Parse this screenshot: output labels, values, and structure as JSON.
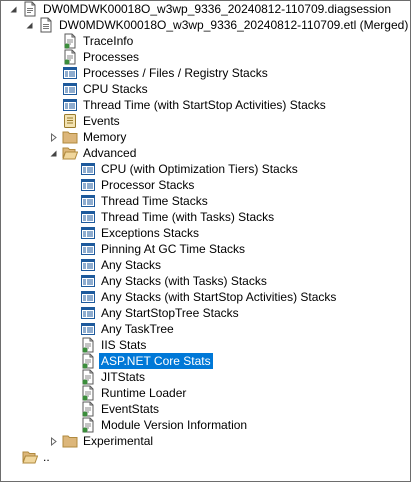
{
  "tree": {
    "root": {
      "label": "DW0MDWK00018O_w3wp_9336_20240812-110709.diagsession",
      "icon": "diagsession-file-icon",
      "expanded": true
    },
    "etl": {
      "label": "DW0MDWK00018O_w3wp_9336_20240812-110709.etl (Merged)",
      "icon": "etl-file-icon",
      "expanded": true
    },
    "top_items": [
      {
        "label": "TraceInfo",
        "icon": "document-icon"
      },
      {
        "label": "Processes",
        "icon": "document-icon"
      },
      {
        "label": "Processes / Files / Registry Stacks",
        "icon": "stack-view-icon"
      },
      {
        "label": "CPU Stacks",
        "icon": "stack-view-icon"
      },
      {
        "label": "Thread Time (with StartStop Activities) Stacks",
        "icon": "stack-view-icon"
      },
      {
        "label": "Events",
        "icon": "events-icon"
      }
    ],
    "memory": {
      "label": "Memory",
      "icon": "folder-icon",
      "expanded": false
    },
    "advanced": {
      "label": "Advanced",
      "icon": "folder-open-icon",
      "expanded": true
    },
    "advanced_items": [
      {
        "label": "CPU (with Optimization Tiers) Stacks",
        "icon": "stack-view-icon"
      },
      {
        "label": "Processor Stacks",
        "icon": "stack-view-icon"
      },
      {
        "label": "Thread Time Stacks",
        "icon": "stack-view-icon"
      },
      {
        "label": "Thread Time (with Tasks) Stacks",
        "icon": "stack-view-icon"
      },
      {
        "label": "Exceptions Stacks",
        "icon": "stack-view-icon"
      },
      {
        "label": "Pinning At GC Time Stacks",
        "icon": "stack-view-icon"
      },
      {
        "label": "Any Stacks",
        "icon": "stack-view-icon"
      },
      {
        "label": "Any Stacks (with Tasks) Stacks",
        "icon": "stack-view-icon"
      },
      {
        "label": "Any Stacks (with StartStop Activities) Stacks",
        "icon": "stack-view-icon"
      },
      {
        "label": "Any StartStopTree Stacks",
        "icon": "stack-view-icon"
      },
      {
        "label": "Any TaskTree",
        "icon": "stack-view-icon"
      },
      {
        "label": "IIS Stats",
        "icon": "document-icon"
      },
      {
        "label": "ASP.NET Core Stats",
        "icon": "document-icon",
        "selected": true
      },
      {
        "label": "JITStats",
        "icon": "document-icon"
      },
      {
        "label": "Runtime Loader",
        "icon": "document-icon"
      },
      {
        "label": "EventStats",
        "icon": "document-icon"
      },
      {
        "label": "Module Version Information",
        "icon": "document-icon"
      }
    ],
    "experimental": {
      "label": "Experimental",
      "icon": "folder-icon",
      "expanded": false
    },
    "parent": {
      "label": "..",
      "icon": "folder-open-icon"
    }
  },
  "colors": {
    "selection": "#0078d7",
    "folder": "#dcb67a",
    "stack_icon": "#1e5a9c",
    "doc_green": "#3c8d3c"
  }
}
